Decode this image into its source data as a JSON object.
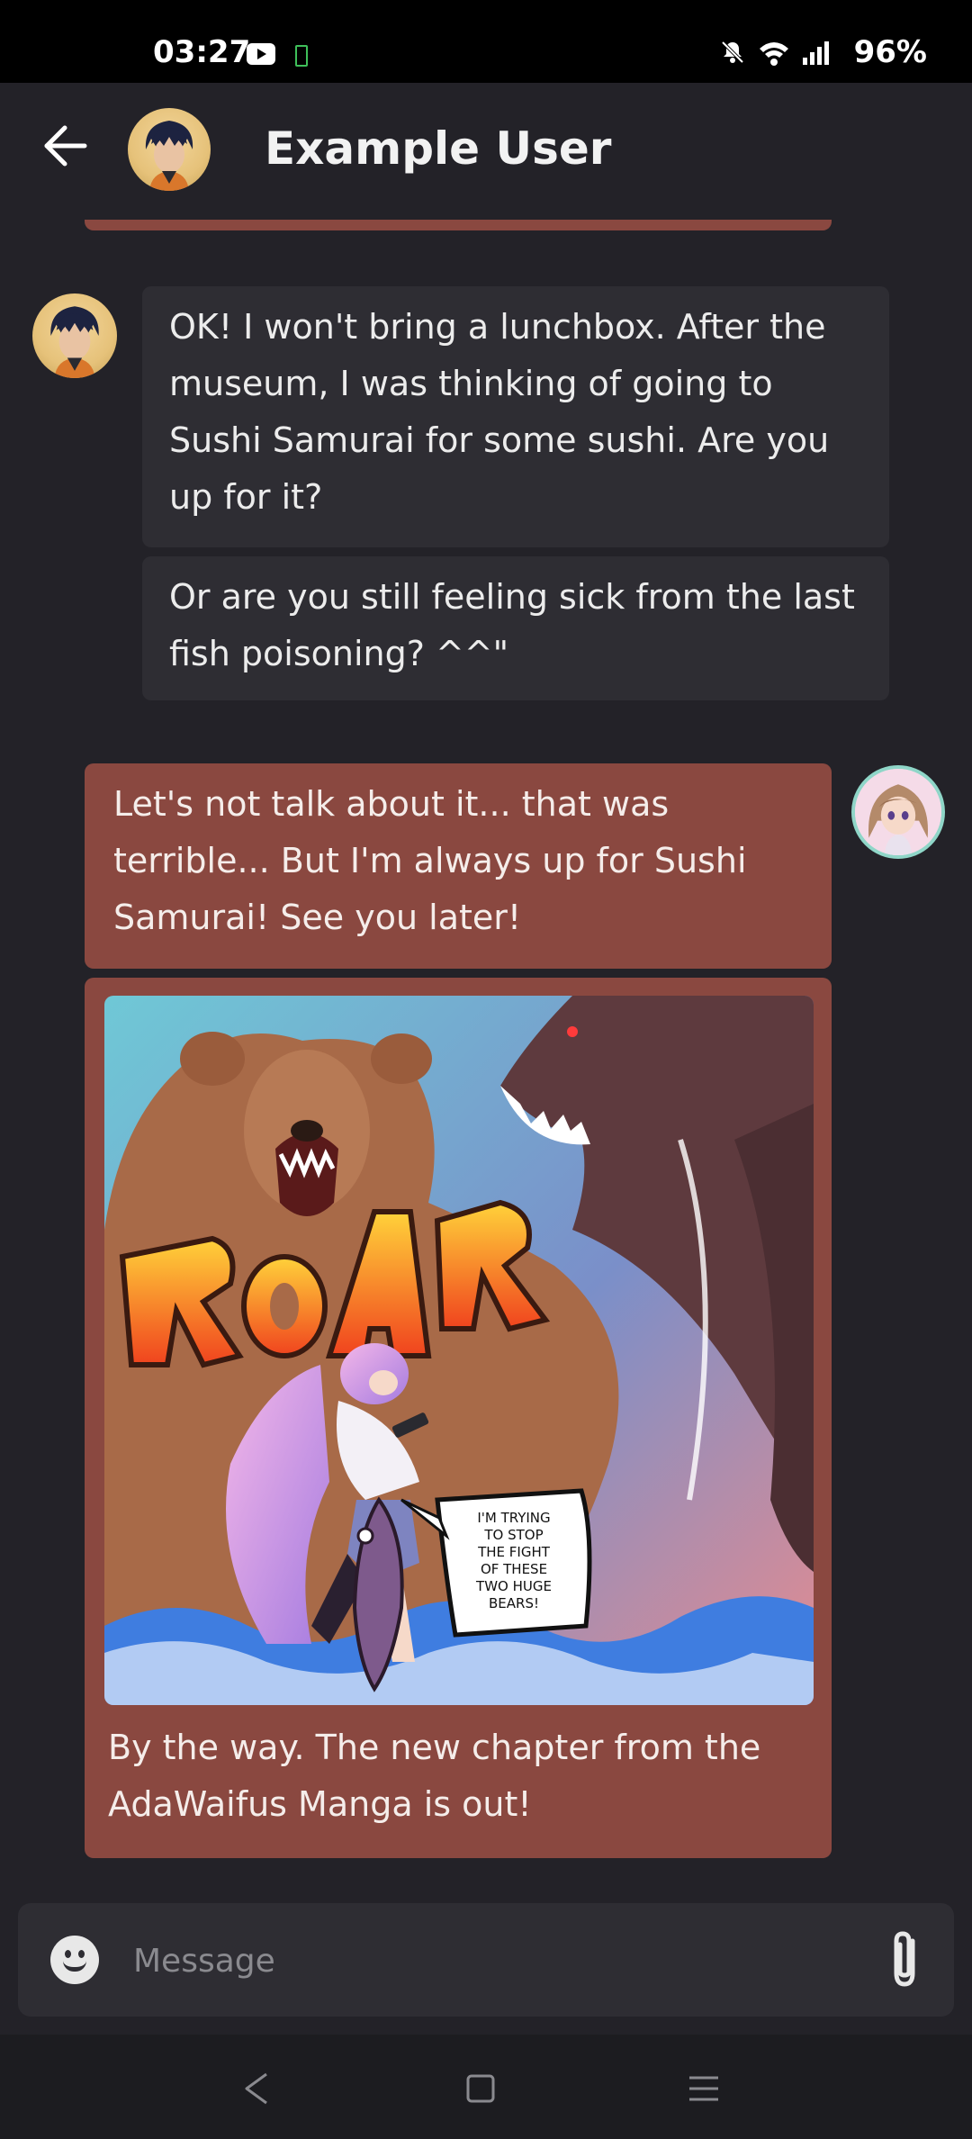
{
  "status_bar": {
    "time": "03:27",
    "battery_percent": "96%",
    "icons": [
      "youtube-icon",
      "battery-saver-icon",
      "bell-off-icon",
      "wifi-icon",
      "signal-icon"
    ]
  },
  "header": {
    "title": "Example User",
    "back_icon": "arrow-left-icon"
  },
  "messages": [
    {
      "sender": "other",
      "text": "OK! I won't bring a lunchbox. After the museum, I was thinking of going to Sushi Samurai for some sushi. Are you up for it?"
    },
    {
      "sender": "other",
      "text": "Or are you still feeling sick from the last fish poisoning? ^^\""
    },
    {
      "sender": "me",
      "text": "Let's not talk about it... that was terrible... But I'm always up for Sushi Samurai! See you later!"
    },
    {
      "sender": "me",
      "image": {
        "sfx_text": "ROAR",
        "speech_text": "I'M TRYING TO STOP THE FIGHT OF THESE TWO HUGE BEARS!"
      },
      "text": "By the way. The new chapter from the AdaWaifus Manga is out!"
    }
  ],
  "composer": {
    "placeholder": "Message",
    "emoji_icon": "smiley-icon",
    "attach_icon": "paperclip-icon"
  },
  "colors": {
    "background": "#232228",
    "incoming_bubble": "#2E2D33",
    "outgoing_bubble": "#8A4840"
  }
}
